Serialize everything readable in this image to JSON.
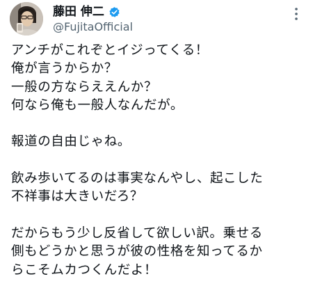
{
  "author": {
    "display_name": "藤田 伸二",
    "handle": "@FujitaOfficial",
    "verified": true,
    "verified_color": "#1d9bf0"
  },
  "icons": {
    "avatar": "profile-photo",
    "verified": "verified-badge-icon",
    "more": "more-options-icon"
  },
  "tweet": {
    "lines": [
      "アンチがこれぞとイジってくる！",
      "俺が言うからか？",
      "一般の方ならええんか？",
      "何なら俺も一般人なんだが。",
      "",
      "報道の自由じゃね。",
      "",
      "飲み歩いてるのは事実なんやし、起こした",
      "不祥事は大きいだろ？",
      "",
      "だからもう少し反省して欲しい訳。乗せる",
      "側もどうかと思うが彼の性格を知ってるか",
      "らこそムカつくんだよ！"
    ]
  }
}
